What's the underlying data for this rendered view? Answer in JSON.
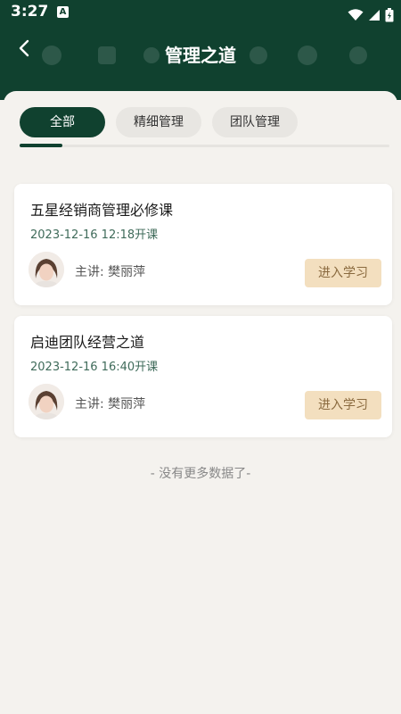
{
  "status_bar": {
    "time": "3:27",
    "app_badge": "A"
  },
  "header": {
    "title": "管理之道"
  },
  "tabs": [
    {
      "label": "全部",
      "active": true
    },
    {
      "label": "精细管理",
      "active": false
    },
    {
      "label": "团队管理",
      "active": false
    }
  ],
  "courses": [
    {
      "title": "五星经销商管理必修课",
      "time": "2023-12-16 12:18开课",
      "lecturer": "主讲: 樊丽萍",
      "action": "进入学习"
    },
    {
      "title": "启迪团队经营之道",
      "time": "2023-12-16 16:40开课",
      "lecturer": "主讲: 樊丽萍",
      "action": "进入学习"
    }
  ],
  "footer": {
    "no_more": "- 没有更多数据了-"
  },
  "colors": {
    "primary": "#10412f",
    "button_bg": "#f3dfbf",
    "button_text": "#8a6a3f",
    "time_text": "#3f6b5a"
  },
  "icons": {
    "back": "chevron-left-icon",
    "wifi": "wifi-icon",
    "signal": "signal-icon",
    "battery": "battery-icon"
  }
}
